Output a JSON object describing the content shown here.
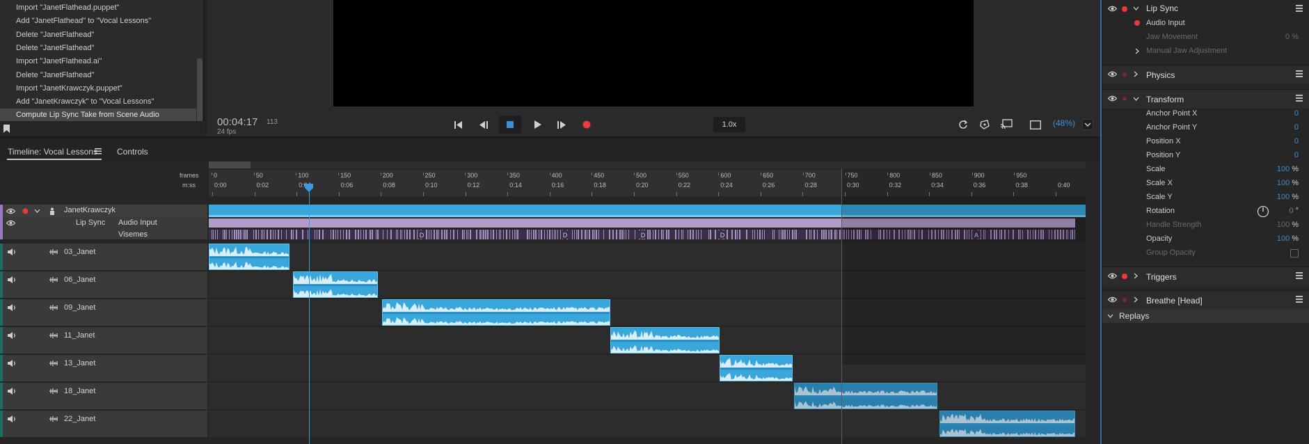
{
  "history": {
    "items": [
      "Import \"JanetFlathead.puppet\"",
      "Add \"JanetFlathead\" to \"Vocal Lessons\"",
      "Delete \"JanetFlathead\"",
      "Delete \"JanetFlathead\"",
      "Import \"JanetFlathead.ai\"",
      "Delete \"JanetFlathead\"",
      "Import \"JanetKrawczyk.puppet\"",
      "Add \"JanetKrawczyk\" to \"Vocal Lessons\"",
      "Compute Lip Sync Take from Scene Audio"
    ],
    "selected_index": 8
  },
  "transport": {
    "timecode": "00:04:17",
    "frame": "113",
    "fps": "24 fps",
    "speed": "1.0x",
    "zoom": "(48%)"
  },
  "tabs": {
    "timeline": "Timeline: Vocal Lessons",
    "controls": "Controls"
  },
  "ruler": {
    "frames_label": "frames",
    "mss_label": "m:ss",
    "frame_ticks": [
      "0",
      "50",
      "100",
      "150",
      "200",
      "250",
      "300",
      "350",
      "400",
      "450",
      "500",
      "550",
      "600",
      "650",
      "700",
      "750",
      "800",
      "850",
      "900",
      "950"
    ],
    "time_ticks": [
      "0:00",
      "0:02",
      "0:04",
      "0:06",
      "0:08",
      "0:10",
      "0:12",
      "0:14",
      "0:16",
      "0:18",
      "0:20",
      "0:22",
      "0:24",
      "0:26",
      "0:28",
      "0:30",
      "0:32",
      "0:34",
      "0:36",
      "0:38",
      "0:40"
    ]
  },
  "puppet_track": {
    "name": "JanetKrawczyk",
    "lipsync": "Lip Sync",
    "audio_input": "Audio Input",
    "visemes": "Visemes",
    "viseme_letters": [
      "D",
      "D",
      "D",
      "D",
      "A"
    ]
  },
  "audio_tracks": [
    {
      "name": "03_Janet"
    },
    {
      "name": "06_Janet"
    },
    {
      "name": "09_Janet"
    },
    {
      "name": "11_Janet"
    },
    {
      "name": "13_Janet"
    },
    {
      "name": "18_Janet"
    },
    {
      "name": "22_Janet"
    }
  ],
  "properties": {
    "lip_sync": {
      "title": "Lip Sync",
      "audio_input": "Audio Input",
      "jaw_movement": "Jaw Movement",
      "jaw_value": "0 %",
      "manual_jaw": "Manual Jaw Adjustment"
    },
    "physics": "Physics",
    "transform": {
      "title": "Transform",
      "rows": [
        {
          "label": "Anchor Point X",
          "value": "0",
          "unit": ""
        },
        {
          "label": "Anchor Point Y",
          "value": "0",
          "unit": ""
        },
        {
          "label": "Position X",
          "value": "0",
          "unit": ""
        },
        {
          "label": "Position Y",
          "value": "0",
          "unit": ""
        },
        {
          "label": "Scale",
          "value": "100",
          "unit": "%"
        },
        {
          "label": "Scale X",
          "value": "100",
          "unit": "%"
        },
        {
          "label": "Scale Y",
          "value": "100",
          "unit": "%"
        },
        {
          "label": "Rotation",
          "value": "0",
          "unit": "°"
        },
        {
          "label": "Handle Strength",
          "value": "100",
          "unit": "%"
        },
        {
          "label": "Opacity",
          "value": "100",
          "unit": "%"
        },
        {
          "label": "Group Opacity",
          "value": "",
          "unit": ""
        }
      ]
    },
    "triggers": "Triggers",
    "breathe": "Breathe [Head]",
    "replays": "Replays"
  },
  "colors": {
    "accent": "#3a90d8",
    "clip": "#3aa7dc",
    "record": "#e83b3b",
    "lipsync_bar": "#b39cc9"
  }
}
